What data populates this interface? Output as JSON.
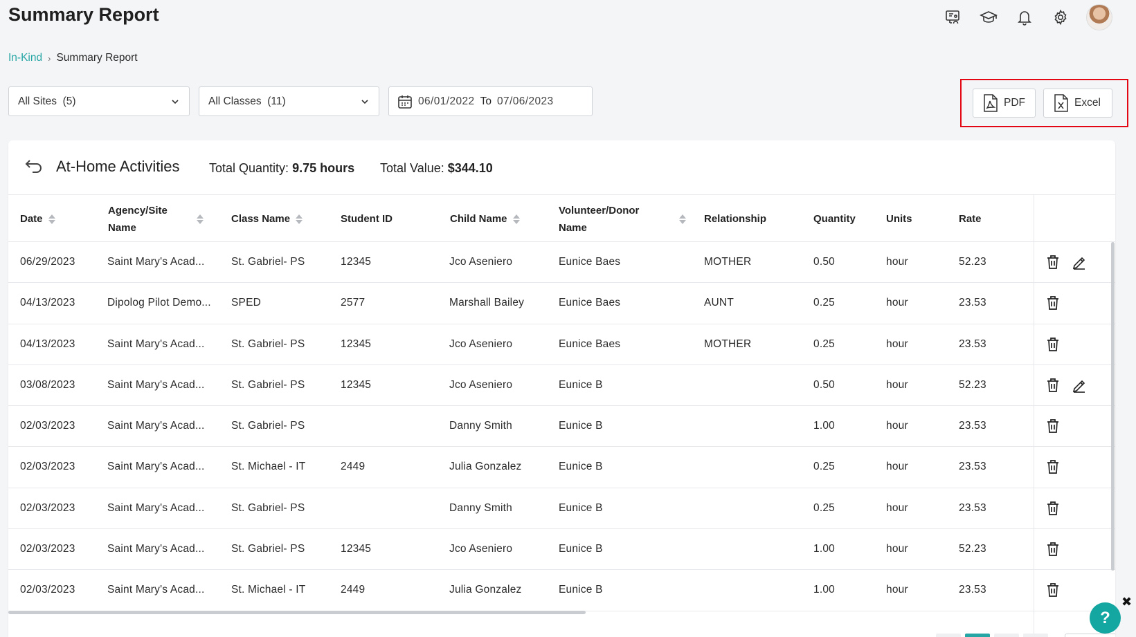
{
  "page": {
    "title": "Summary Report"
  },
  "top_icons": [
    "presentation-icon",
    "graduation-cap-icon",
    "bell-icon",
    "gear-icon"
  ],
  "breadcrumb": {
    "parent": "In-Kind",
    "current": "Summary Report"
  },
  "filters": {
    "sites": "All Sites  (5)",
    "classes": "All Classes  (11)",
    "date_from": "06/01/2022",
    "date_to_label": "To",
    "date_to": "07/06/2023"
  },
  "export": {
    "pdf_label": "PDF",
    "excel_label": "Excel"
  },
  "card": {
    "title": "At-Home Activities",
    "total_quantity_label": "Total Quantity:",
    "total_quantity_value": "9.75 hours",
    "total_value_label": "Total Value:",
    "total_value_value": "$344.10"
  },
  "table": {
    "headers": {
      "date": "Date",
      "agency_1": "Agency/Site",
      "agency_2": "Name",
      "class_name": "Class Name",
      "student_id": "Student ID",
      "child_name": "Child Name",
      "volunteer_1": "Volunteer/Donor",
      "volunteer_2": "Name",
      "relationship": "Relationship",
      "quantity": "Quantity",
      "units": "Units",
      "rate": "Rate"
    },
    "rows": [
      {
        "date": "06/29/2023",
        "agency": "Saint Mary's Acad...",
        "class_name": "St. Gabriel- PS",
        "student_id": "12345",
        "child_name": "Jco Aseniero",
        "volunteer": "Eunice Baes",
        "relationship": "MOTHER",
        "quantity": "0.50",
        "units": "hour",
        "rate": "52.23",
        "editable": true
      },
      {
        "date": "04/13/2023",
        "agency": "Dipolog Pilot Demo...",
        "class_name": "SPED",
        "student_id": "2577",
        "child_name": "Marshall Bailey",
        "volunteer": "Eunice Baes",
        "relationship": "AUNT",
        "quantity": "0.25",
        "units": "hour",
        "rate": "23.53",
        "editable": false
      },
      {
        "date": "04/13/2023",
        "agency": "Saint Mary's Acad...",
        "class_name": "St. Gabriel- PS",
        "student_id": "12345",
        "child_name": "Jco Aseniero",
        "volunteer": "Eunice Baes",
        "relationship": "MOTHER",
        "quantity": "0.25",
        "units": "hour",
        "rate": "23.53",
        "editable": false
      },
      {
        "date": "03/08/2023",
        "agency": "Saint Mary's Acad...",
        "class_name": "St. Gabriel- PS",
        "student_id": "12345",
        "child_name": "Jco Aseniero",
        "volunteer": "Eunice B",
        "relationship": "",
        "quantity": "0.50",
        "units": "hour",
        "rate": "52.23",
        "editable": true
      },
      {
        "date": "02/03/2023",
        "agency": "Saint Mary's Acad...",
        "class_name": "St. Gabriel- PS",
        "student_id": "",
        "child_name": "Danny Smith",
        "volunteer": "Eunice B",
        "relationship": "",
        "quantity": "1.00",
        "units": "hour",
        "rate": "23.53",
        "editable": false
      },
      {
        "date": "02/03/2023",
        "agency": "Saint Mary's Acad...",
        "class_name": "St. Michael - IT",
        "student_id": "2449",
        "child_name": "Julia Gonzalez",
        "volunteer": "Eunice B",
        "relationship": "",
        "quantity": "0.25",
        "units": "hour",
        "rate": "23.53",
        "editable": false
      },
      {
        "date": "02/03/2023",
        "agency": "Saint Mary's Acad...",
        "class_name": "St. Gabriel- PS",
        "student_id": "",
        "child_name": "Danny Smith",
        "volunteer": "Eunice B",
        "relationship": "",
        "quantity": "0.25",
        "units": "hour",
        "rate": "23.53",
        "editable": false
      },
      {
        "date": "02/03/2023",
        "agency": "Saint Mary's Acad...",
        "class_name": "St. Gabriel- PS",
        "student_id": "12345",
        "child_name": "Jco Aseniero",
        "volunteer": "Eunice B",
        "relationship": "",
        "quantity": "1.00",
        "units": "hour",
        "rate": "52.23",
        "editable": false
      },
      {
        "date": "02/03/2023",
        "agency": "Saint Mary's Acad...",
        "class_name": "St. Michael - IT",
        "student_id": "2449",
        "child_name": "Julia Gonzalez",
        "volunteer": "Eunice B",
        "relationship": "",
        "quantity": "1.00",
        "units": "hour",
        "rate": "23.53",
        "editable": false
      }
    ]
  },
  "help": {
    "label": "?",
    "close_label": "✖"
  },
  "colors": {
    "accent": "#26a6a4",
    "highlight": "#e30613",
    "help": "#14a6a0"
  }
}
